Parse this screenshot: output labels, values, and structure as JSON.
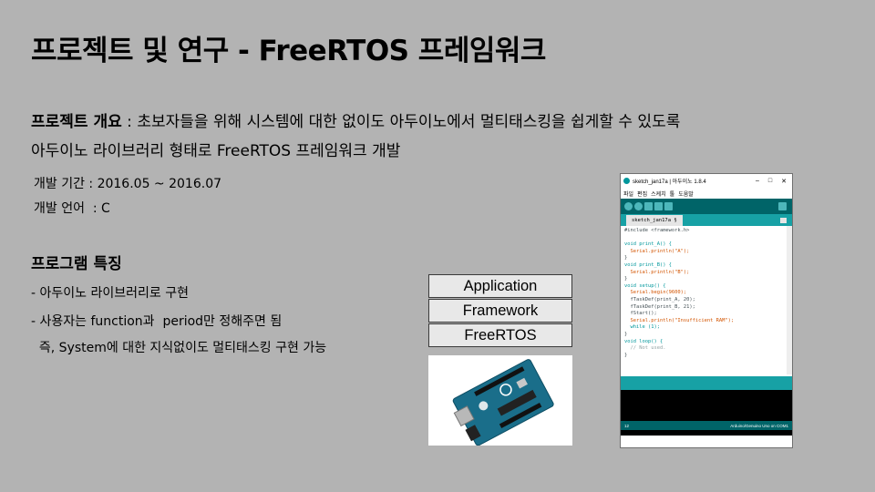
{
  "slide": {
    "title": "프로젝트 및 연구 - FreeRTOS 프레임워크",
    "intro": {
      "label": "프로젝트 개요",
      "sep": " : ",
      "line1": "초보자들을 위해 시스템에 대한 없이도 아두이노에서 멀티태스킹을 쉽게할 수 있도록",
      "line2": "아두이노 라이브러리 형태로 FreeRTOS 프레임워크 개발"
    },
    "period": "개발 기간 : 2016.05 ~ 2016.07",
    "language": "개발 언어  : C",
    "features_title": "프로그램 특징",
    "features": [
      "- 아두이노 라이브러리로 구현",
      "- 사용자는 function과  period만 정해주면 됨",
      "  즉, System에 대한 지식없이도 멀티태스킹 구현 가능"
    ],
    "stack": [
      "Application",
      "Framework",
      "FreeRTOS"
    ]
  },
  "ide": {
    "window_title": "sketch_jan17a | 아두이노 1.8.4",
    "menu": [
      "파일",
      "편집",
      "스케치",
      "툴",
      "도움말"
    ],
    "tab": "sketch_jan17a §",
    "code": [
      "#include <framework.h>",
      "",
      "void print_A() {",
      "  Serial.println(\"A\");",
      "}",
      "void print_B() {",
      "  Serial.println(\"B\");",
      "}",
      "void setup() {",
      "  Serial.begin(9600);",
      "  fTaskDef(print_A, 20);",
      "  fTaskDef(print_B, 21);",
      "  fStart();",
      "  Serial.println(\"Insufficient RAM\");",
      "  while (1);",
      "}",
      "void loop() {",
      "  // Not used.",
      "}"
    ],
    "line_number": "12",
    "board": "Arduino/Genuino Uno on COM1"
  }
}
